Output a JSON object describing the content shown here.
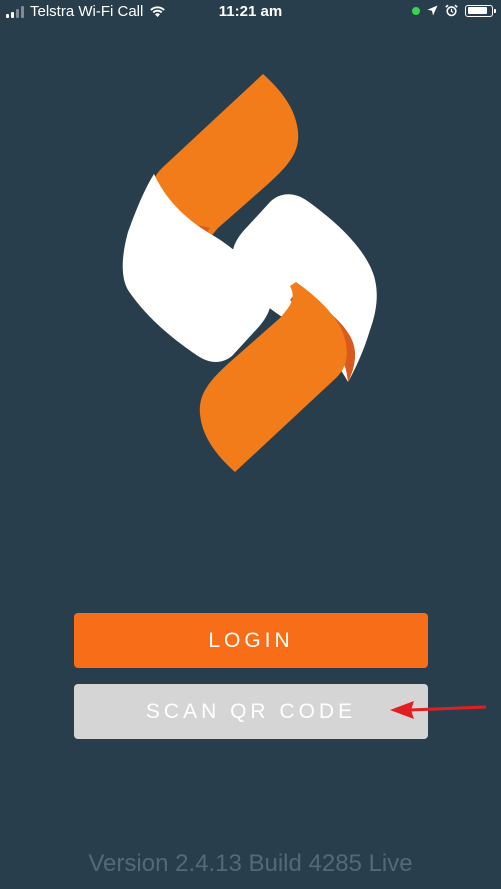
{
  "status_bar": {
    "carrier": "Telstra Wi-Fi Call",
    "time": "11:21 am",
    "icons": [
      "signal-icon",
      "wifi-icon",
      "location-icon",
      "alarm-icon",
      "battery-icon"
    ],
    "battery_level": 0.85
  },
  "logo": {
    "icon": "s-logo-icon"
  },
  "buttons": {
    "login_label": "LOGIN",
    "scan_label": "SCAN QR CODE"
  },
  "annotation": {
    "icon": "red-arrow-icon"
  },
  "footer": {
    "version": "Version 2.4.13 Build 4285 Live"
  },
  "colors": {
    "background": "#293e4c",
    "accent": "#f86d17",
    "accent_dark": "#d85a1e",
    "secondary_button": "#d5d5d5",
    "annotation_arrow": "#e02020"
  }
}
